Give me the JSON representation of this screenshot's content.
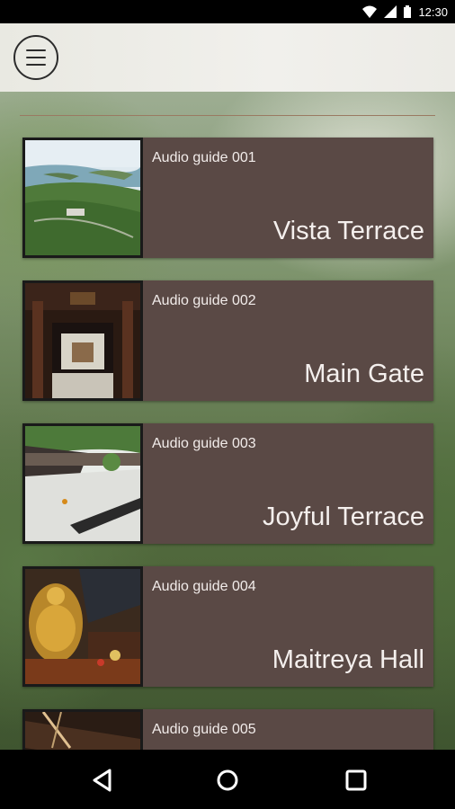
{
  "status_bar": {
    "time": "12:30"
  },
  "header": {
    "menu_icon": "hamburger-menu-icon"
  },
  "guides": [
    {
      "label": "Audio guide 001",
      "title": "Vista Terrace"
    },
    {
      "label": "Audio guide 002",
      "title": "Main Gate"
    },
    {
      "label": "Audio guide 003",
      "title": "Joyful Terrace"
    },
    {
      "label": "Audio guide 004",
      "title": "Maitreya Hall"
    },
    {
      "label": "Audio guide 005",
      "title": ""
    }
  ],
  "nav": {
    "back_icon": "back-triangle-icon",
    "home_icon": "home-circle-icon",
    "recents_icon": "recents-square-icon"
  },
  "colors": {
    "card": "#5a4945",
    "card_text": "#f4efed",
    "status_bar": "#000000",
    "nav_bar": "#000000",
    "divider": "#9a7a62"
  }
}
